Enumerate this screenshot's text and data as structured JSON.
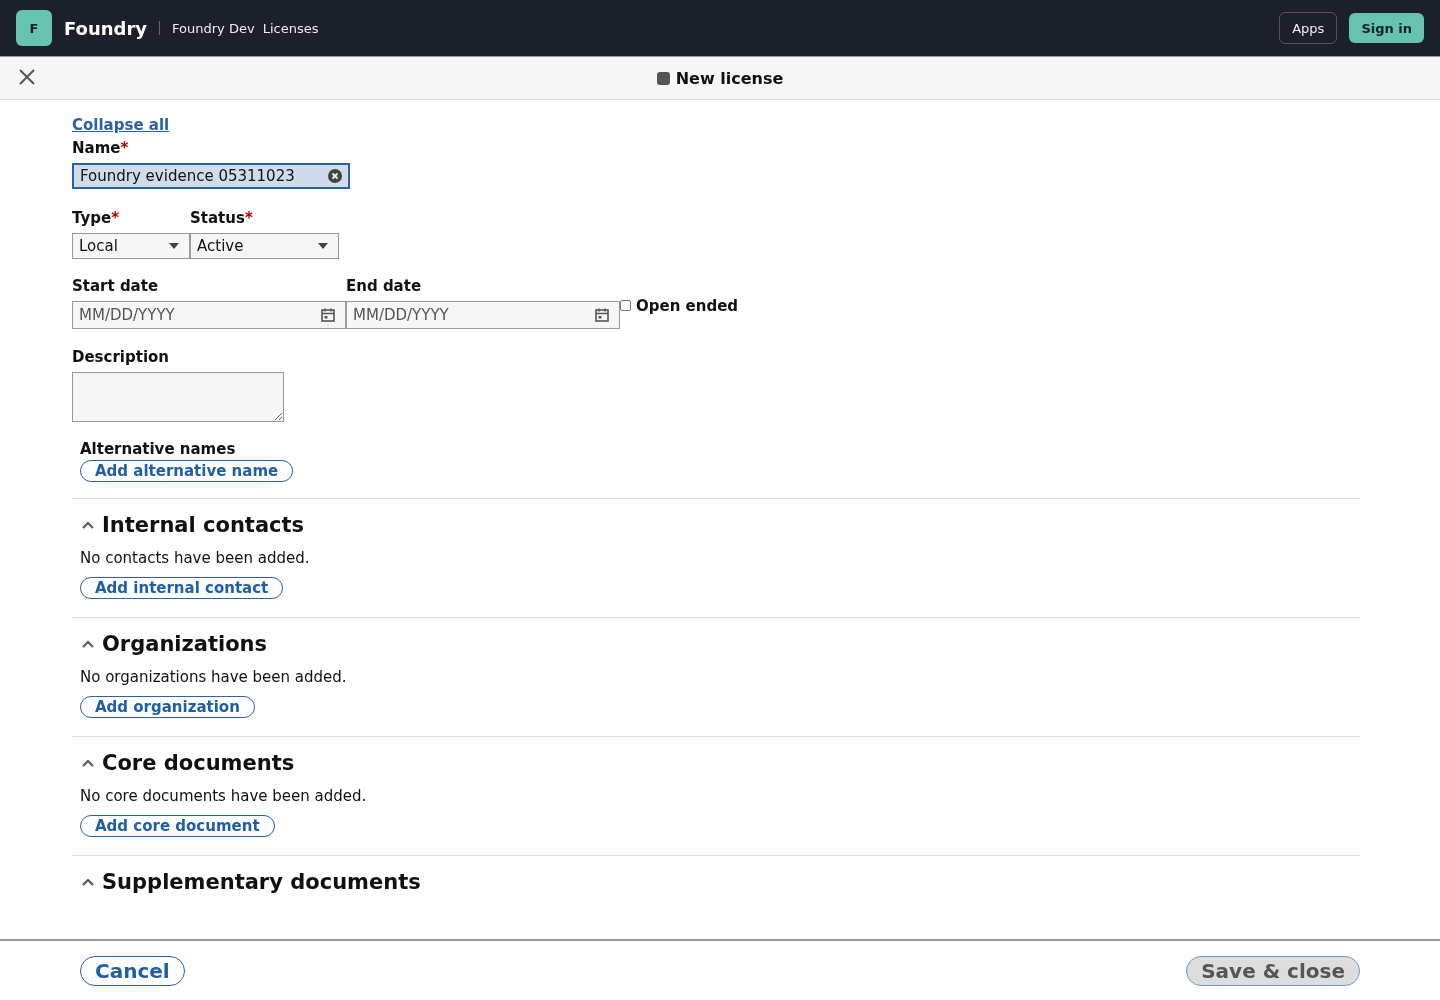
{
  "header": {
    "logo_letter": "F",
    "app_name": "Foundry",
    "breadcrumbs": [
      "Foundry Dev",
      "Licenses"
    ],
    "buttons": [
      {
        "label": "Apps",
        "kind": "outline"
      },
      {
        "label": "Sign in",
        "kind": "primary"
      }
    ]
  },
  "pane": {
    "title": "New license"
  },
  "collapse_link": "Collapse all",
  "fields": {
    "name": {
      "label": "Name",
      "required_mark": "*",
      "value": "Foundry evidence 05311023"
    },
    "type": {
      "label": "Type",
      "required_mark": "*",
      "value": "Local"
    },
    "status": {
      "label": "Status",
      "required_mark": "*",
      "value": "Active"
    },
    "start_date": {
      "label": "Start date",
      "placeholder": "MM/DD/YYYY"
    },
    "end_date": {
      "label": "End date",
      "placeholder": "MM/DD/YYYY"
    },
    "open_ended": {
      "label": "Open ended",
      "checked": false
    },
    "description": {
      "label": "Description"
    }
  },
  "alternative_names": {
    "label": "Alternative names",
    "button": "Add alternative name"
  },
  "sections": [
    {
      "title": "Internal contacts",
      "expanded": true,
      "message": "No contacts have been added.",
      "button": "Add internal contact"
    },
    {
      "title": "Organizations",
      "expanded": true,
      "message": "No organizations have been added.",
      "button": "Add organization"
    },
    {
      "title": "Core documents",
      "expanded": true,
      "message": "No core documents have been added.",
      "button": "Add core document"
    },
    {
      "title": "Supplementary documents",
      "expanded": true
    }
  ],
  "footer": {
    "cancel": {
      "label": "Cancel",
      "disabled": false
    },
    "save": {
      "label": "Save & close",
      "disabled": true
    }
  }
}
